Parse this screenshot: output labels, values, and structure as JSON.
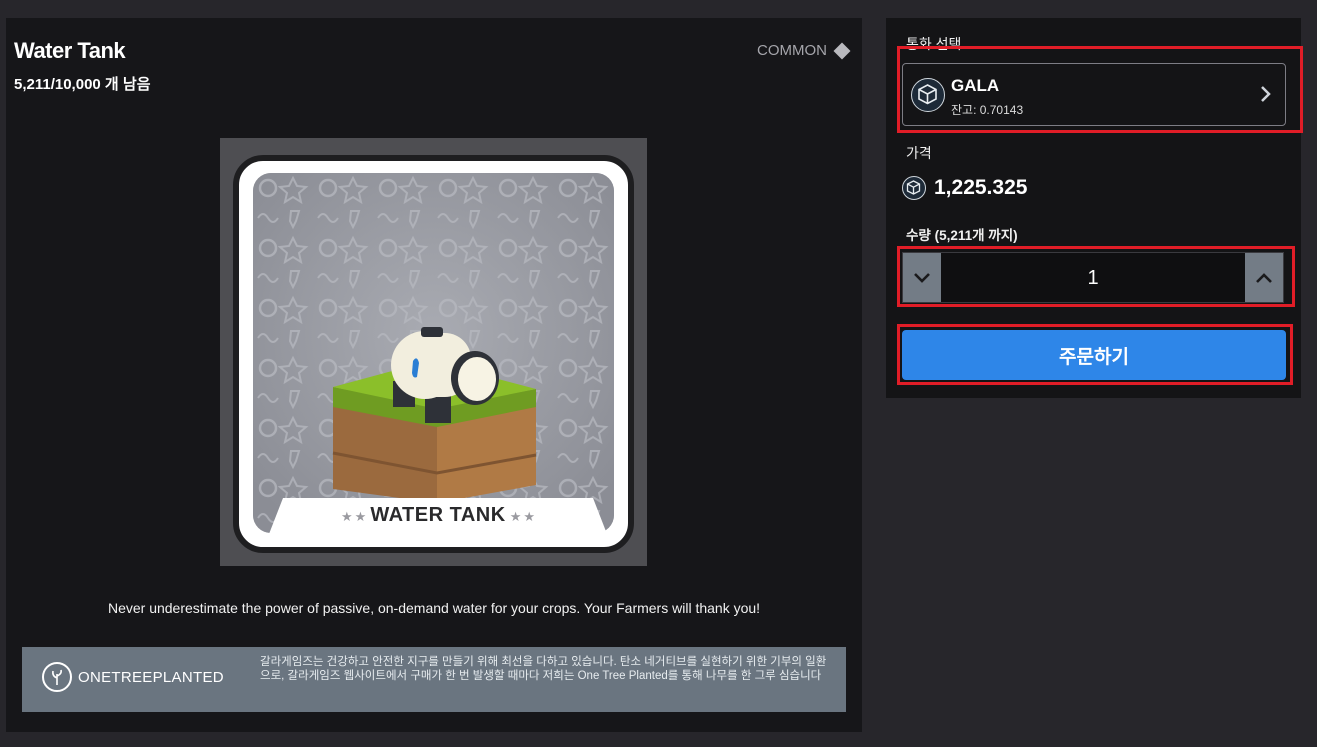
{
  "item": {
    "title": "Water Tank",
    "remaining": "5,211/10,000 개 남음",
    "rarity": "COMMON",
    "card_label": "WATER TANK",
    "card_stars_left": "★★",
    "card_stars_right": "★★",
    "description": "Never underestimate the power of passive, on-demand water for your crops. Your Farmers will thank you!"
  },
  "partner": {
    "logo_text": "ONETREEPLANTED",
    "text": "갈라게임즈는 건강하고 안전한 지구를 만들기 위해 최선을 다하고 있습니다. 탄소 네거티브를 실현하기 위한 기부의 일환으로, 갈라게임즈 웹사이트에서 구매가 한 번 발생할 때마다 저희는 One Tree Planted를 통해 나무를 한 그루 심습니다"
  },
  "purchase": {
    "currency_label": "통화 선택",
    "currency": {
      "name": "GALA",
      "balance": "잔고: 0.70143",
      "icon": "gala-token-icon"
    },
    "price_label": "가격",
    "price": "1,225.325",
    "quantity_label": "수량 (5,211개 까지)",
    "quantity": "1",
    "order_button": "주문하기"
  },
  "colors": {
    "accent": "#2e86e8",
    "highlight": "#e11d27",
    "panel": "#161619",
    "background": "#27262b"
  }
}
